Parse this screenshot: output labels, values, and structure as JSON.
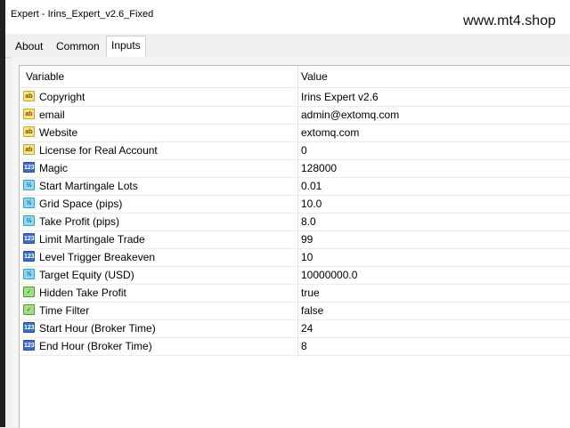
{
  "window": {
    "title": "Expert - Irins_Expert_v2.6_Fixed"
  },
  "watermark": "www.mt4.shop",
  "tabs": [
    {
      "label": "About",
      "active": false
    },
    {
      "label": "Common",
      "active": false
    },
    {
      "label": "Inputs",
      "active": true
    }
  ],
  "table": {
    "headers": {
      "variable": "Variable",
      "value": "Value"
    },
    "rows": [
      {
        "icon": "string-icon",
        "badge": "ab",
        "name": "Copyright",
        "value": "Irins Expert v2.6"
      },
      {
        "icon": "string-icon",
        "badge": "ab",
        "name": "email",
        "value": "admin@extomq.com"
      },
      {
        "icon": "string-icon",
        "badge": "ab",
        "name": "Website",
        "value": "extomq.com"
      },
      {
        "icon": "string-icon",
        "badge": "ab",
        "name": "License for Real Account",
        "value": "0"
      },
      {
        "icon": "integer-icon",
        "badge": "123",
        "name": "Magic",
        "value": "128000"
      },
      {
        "icon": "double-icon",
        "badge": "½",
        "name": "Start Martingale Lots",
        "value": "0.01"
      },
      {
        "icon": "double-icon",
        "badge": "½",
        "name": "Grid Space (pips)",
        "value": "10.0"
      },
      {
        "icon": "double-icon",
        "badge": "½",
        "name": "Take Profit (pips)",
        "value": "8.0"
      },
      {
        "icon": "integer-icon",
        "badge": "123",
        "name": "Limit Martingale Trade",
        "value": "99"
      },
      {
        "icon": "integer-icon",
        "badge": "123",
        "name": "Level Trigger Breakeven",
        "value": "10"
      },
      {
        "icon": "double-icon",
        "badge": "½",
        "name": "Target Equity (USD)",
        "value": "10000000.0"
      },
      {
        "icon": "boolean-icon",
        "badge": "✓",
        "name": "Hidden Take Profit",
        "value": "true"
      },
      {
        "icon": "boolean-icon",
        "badge": "✓",
        "name": "Time Filter",
        "value": "false"
      },
      {
        "icon": "integer-icon",
        "badge": "123",
        "name": "Start Hour (Broker Time)",
        "value": "24"
      },
      {
        "icon": "integer-icon",
        "badge": "123",
        "name": "End Hour (Broker Time)",
        "value": "8"
      }
    ]
  }
}
